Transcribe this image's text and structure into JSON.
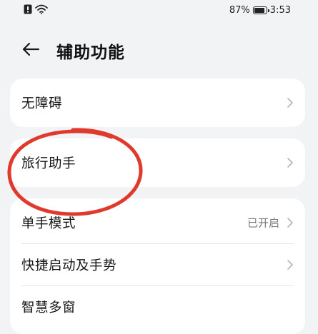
{
  "status_bar": {
    "battery_percent_text": "87%",
    "battery_level": 0.87,
    "time": "3:53",
    "icons": [
      "notification-icon",
      "wifi-icon",
      "battery-icon"
    ]
  },
  "header": {
    "title": "辅助功能",
    "back_icon": "arrow-left-icon"
  },
  "groups": [
    {
      "items": [
        {
          "label": "无障碍",
          "value": ""
        }
      ]
    },
    {
      "items": [
        {
          "label": "旅行助手",
          "value": ""
        }
      ]
    },
    {
      "items": [
        {
          "label": "单手模式",
          "value": "已开启"
        },
        {
          "label": "快捷启动及手势",
          "value": ""
        },
        {
          "label": "智慧多窗",
          "value": ""
        }
      ]
    }
  ],
  "colors": {
    "background": "#f1f3f5",
    "card": "#ffffff",
    "annotation_circle": "#e03a2e"
  }
}
